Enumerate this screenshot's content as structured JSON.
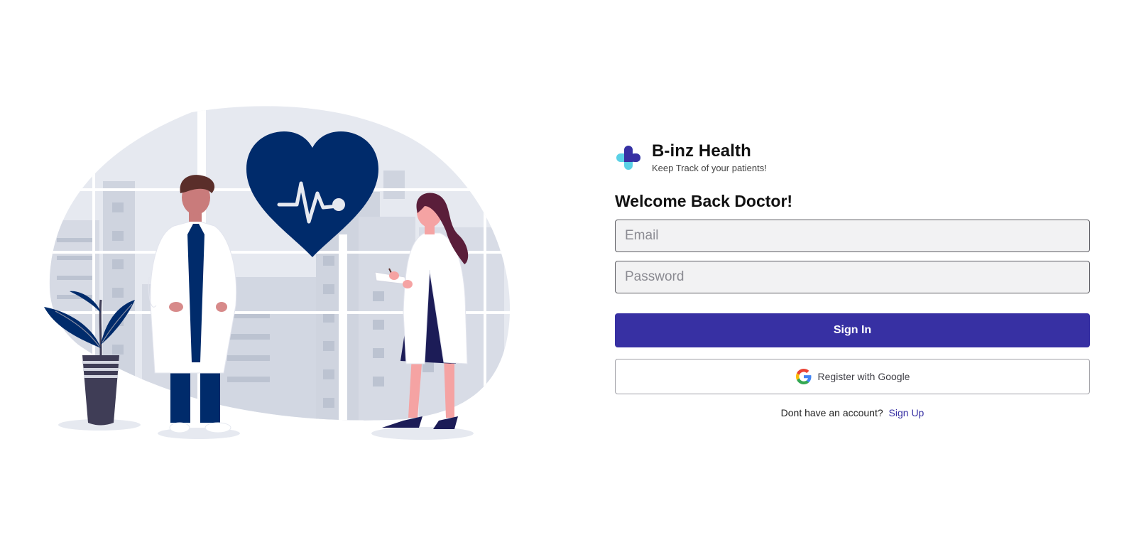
{
  "brand": {
    "name": "B-inz Health",
    "tagline": "Keep Track of your patients!"
  },
  "login": {
    "heading": "Welcome Back Doctor!",
    "email_placeholder": "Email",
    "password_placeholder": "Password",
    "signin_label": "Sign In",
    "google_label": "Register with Google",
    "signup_prompt": "Dont have an account?",
    "signup_link": "Sign Up"
  },
  "colors": {
    "primary": "#3730a3",
    "illustration_navy": "#002b6b",
    "input_bg": "#f2f2f3"
  },
  "icons": [
    "medical-cross-logo-icon",
    "google-g-icon",
    "heartbeat-icon"
  ]
}
